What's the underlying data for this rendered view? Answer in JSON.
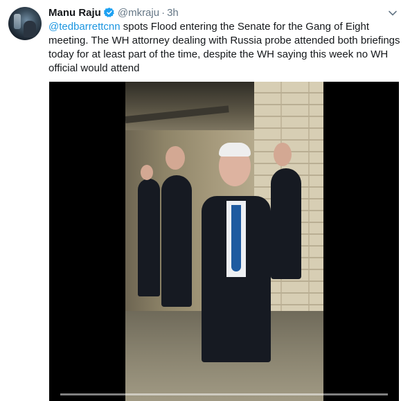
{
  "tweet": {
    "author_name": "Manu Raju",
    "handle": "@mkraju",
    "separator": "·",
    "time": "3h",
    "mention": "@tedbarrettcnn",
    "text_rest": " spots Flood entering the Senate for the Gang of Eight meeting. The WH attorney dealing with Russia probe attended both briefings today for at least part of the time, despite the WH saying this week no WH official would attend"
  },
  "icons": {
    "verified": "verified-badge-icon",
    "caret": "chevron-down-icon"
  },
  "colors": {
    "link": "#1b95e0",
    "verified": "#1da1f2",
    "secondary_text": "#657786"
  },
  "media": {
    "type": "video",
    "progress": 0
  }
}
